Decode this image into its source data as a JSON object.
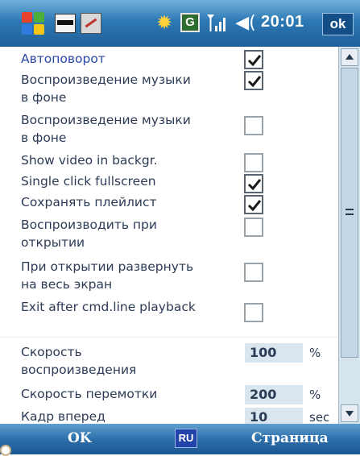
{
  "statusbar": {
    "icons": [
      "start-flag-icon",
      "program-icon",
      "program-icon-2",
      "sun-brightness-icon",
      "g-network-icon",
      "signal-icon",
      "speaker-icon"
    ],
    "g_label": "G",
    "time": "20:01",
    "ok_label": "ok",
    "colors": {
      "bar_top": "#6fb0d8",
      "bar_bottom": "#1f5f99"
    }
  },
  "settings": [
    {
      "label_lines": [
        "Автоповорот"
      ],
      "control": "checkbox",
      "checked": true,
      "accent": true
    },
    {
      "label_lines": [
        "Воспроизведение музыки",
        "в фоне"
      ],
      "control": "checkbox",
      "checked": true
    },
    {
      "label_lines": [
        "Воспроизведение музыки",
        "в фоне"
      ],
      "control": "checkbox",
      "checked": false
    },
    {
      "label_lines": [
        "Show video in backgr."
      ],
      "control": "checkbox",
      "checked": false
    },
    {
      "label_lines": [
        "Single click fullscreen"
      ],
      "control": "checkbox",
      "checked": true
    },
    {
      "label_lines": [
        "Сохранять плейлист"
      ],
      "control": "checkbox",
      "checked": true
    },
    {
      "label_lines": [
        "Воспроизводить при",
        "открытии"
      ],
      "control": "checkbox",
      "checked": false
    },
    {
      "label_lines": [
        "При открытии развернуть",
        "на весь экран"
      ],
      "control": "checkbox",
      "checked": false
    },
    {
      "label_lines": [
        "Exit after cmd.line playback"
      ],
      "control": "checkbox",
      "checked": false
    }
  ],
  "values": [
    {
      "label_lines": [
        "Скорость",
        "воспроизведения"
      ],
      "value": "100",
      "unit": "%"
    },
    {
      "label_lines": [
        "Скорость перемотки"
      ],
      "value": "200",
      "unit": "%"
    },
    {
      "label_lines": [
        "Кадр вперед"
      ],
      "value": "10",
      "unit": "sec"
    }
  ],
  "softkeys": {
    "left": "OK",
    "input_lang": "RU",
    "right": "Страница"
  }
}
